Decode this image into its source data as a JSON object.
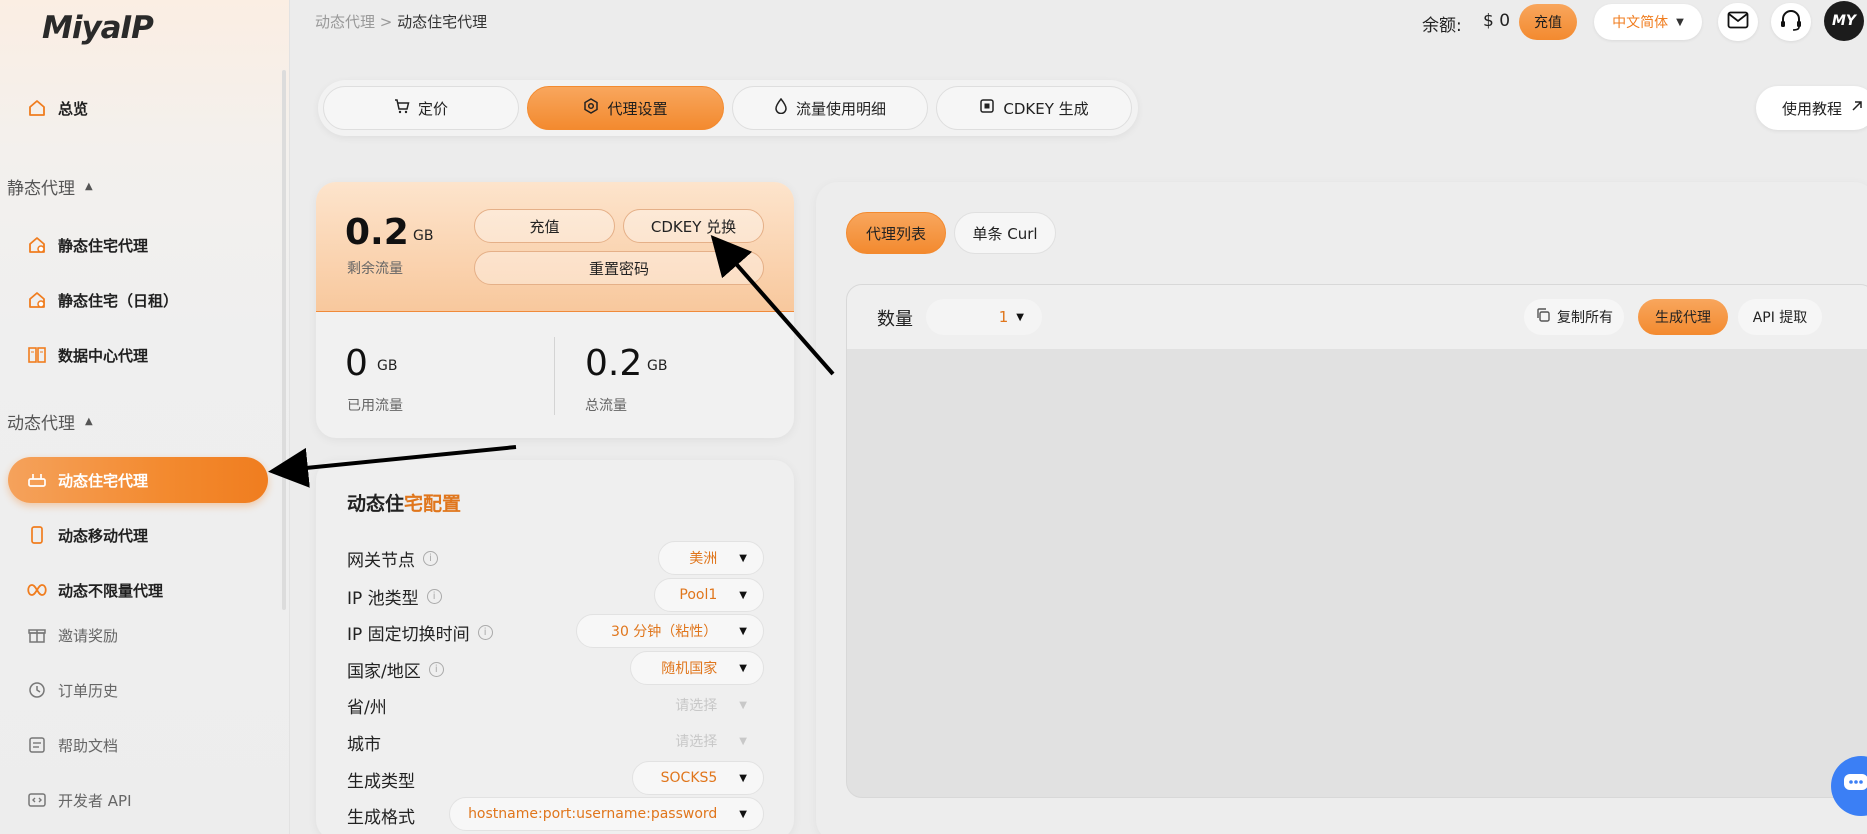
{
  "sidebar": {
    "logo_main": "MiyaIP",
    "overview": "总览",
    "static_section": "静态代理",
    "static_items": [
      "静态住宅代理",
      "静态住宅（日租）",
      "数据中心代理"
    ],
    "dynamic_section": "动态代理",
    "dynamic_items": [
      "动态住宅代理",
      "动态移动代理",
      "动态不限量代理"
    ],
    "misc_items": [
      "邀请奖励",
      "订单历史",
      "帮助文档",
      "开发者 API"
    ]
  },
  "header": {
    "breadcrumb_parent": "动态代理",
    "breadcrumb_sep": ">",
    "breadcrumb_current": "动态住宅代理",
    "balance_label": "余额:",
    "balance_value": "$ 0",
    "topup": "充值",
    "language": "中文简体",
    "avatar_text": "MY"
  },
  "tabs": [
    "定价",
    "代理设置",
    "流量使用明细",
    "CDKEY 生成"
  ],
  "active_tab": "代理设置",
  "tutorial": "使用教程",
  "traffic": {
    "remaining_value": "0.2",
    "remaining_unit": "GB",
    "remaining_label": "剩余流量",
    "topup_btn": "充值",
    "cdkey_btn": "CDKEY 兑换",
    "reset_pwd_btn": "重置密码",
    "used_value": "0",
    "used_unit": "GB",
    "used_label": "已用流量",
    "total_value": "0.2",
    "total_unit": "GB",
    "total_label": "总流量"
  },
  "config": {
    "title_a": "动态住",
    "title_b": "宅配置",
    "rows": [
      {
        "label": "网关节点",
        "value": "美洲",
        "info": true
      },
      {
        "label": "IP 池类型",
        "value": "Pool1",
        "info": true
      },
      {
        "label": "IP 固定切换时间",
        "value": "30 分钟（粘性）",
        "info": true
      },
      {
        "label": "国家/地区",
        "value": "随机国家",
        "info": true
      },
      {
        "label": "省/州",
        "value": "请选择",
        "info": false
      },
      {
        "label": "城市",
        "value": "请选择",
        "info": false
      },
      {
        "label": "生成类型",
        "value": "SOCKS5",
        "info": false
      },
      {
        "label": "生成格式",
        "value": "hostname:port:username:password",
        "info": false
      }
    ]
  },
  "right": {
    "tab_list": "代理列表",
    "tab_curl": "单条 Curl",
    "qty_label": "数量",
    "qty_value": "1",
    "copy_all": "复制所有",
    "generate": "生成代理",
    "api_extract": "API 提取"
  },
  "colors": {
    "accent": "#f38a2f",
    "accent_text": "#e0761c"
  }
}
